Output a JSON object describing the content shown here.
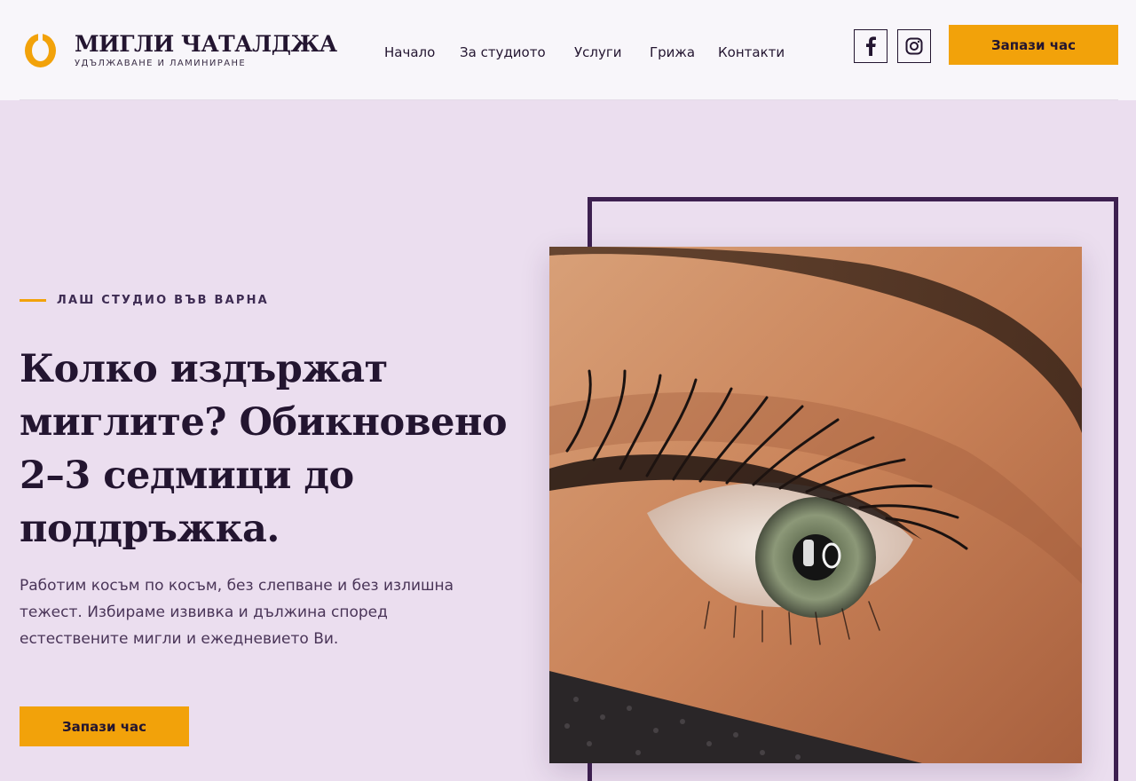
{
  "brand": {
    "title": "МИГЛИ ЧАТАЛДЖА",
    "subtitle": "УДЪЛЖАВАНЕ И ЛАМИНИРАНЕ"
  },
  "nav": {
    "items": [
      {
        "label": "Начало"
      },
      {
        "label": "За студиото"
      },
      {
        "label": "Услуги"
      },
      {
        "label": "Грижа"
      },
      {
        "label": "Контакти"
      }
    ]
  },
  "social": {
    "facebook_icon": "facebook-icon",
    "instagram_icon": "instagram-icon"
  },
  "header": {
    "cta_label": "Запази час"
  },
  "hero": {
    "eyebrow": "ЛАШ СТУДИО ВЪВ ВАРНА",
    "headline_lines": [
      "Колко издържат",
      "миглите? Обикновено",
      "2–3 седмици до",
      "поддръжка."
    ],
    "lead": "Работим косъм по косъм, без слепване и без излишна тежест. Избираме извивка и дължина според естествените мигли и ежедневието Ви.",
    "cta_label": "Запази час",
    "image": "eye-with-eyelash-extensions"
  },
  "colors": {
    "accent": "#f2a20a",
    "background": "#ebdeef",
    "header_bg": "#f8f6fa",
    "frame": "#3d2050",
    "text": "#231530"
  }
}
